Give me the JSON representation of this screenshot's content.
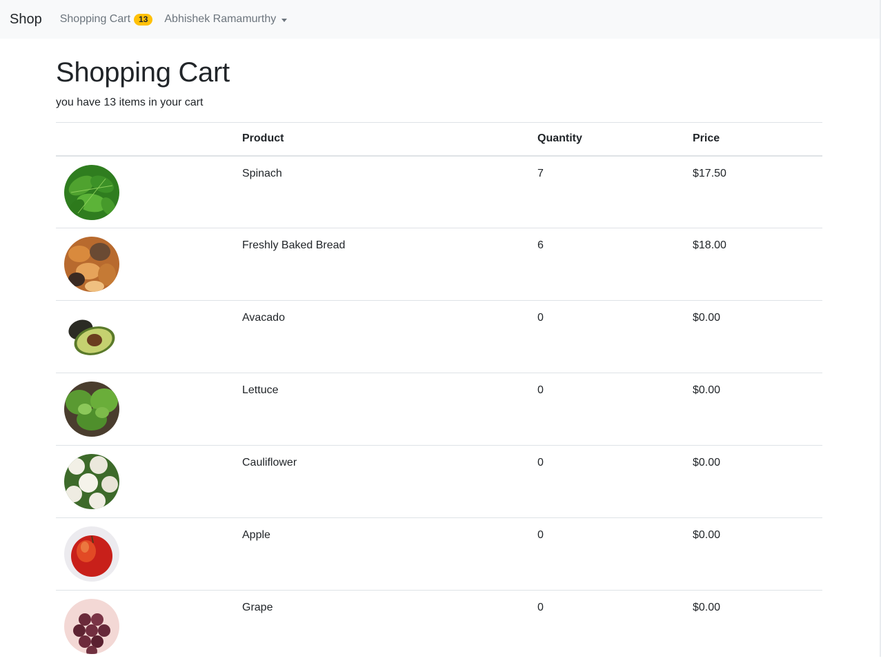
{
  "navbar": {
    "brand": "Shop",
    "cart_label": "Shopping Cart",
    "cart_count": "13",
    "user_name": "Abhishek Ramamurthy"
  },
  "page": {
    "title": "Shopping Cart",
    "subtitle": "you have 13 items in your cart"
  },
  "table": {
    "headers": [
      "",
      "Product",
      "Quantity",
      "Price"
    ],
    "rows": [
      {
        "icon": "spinach-image",
        "product": "Spinach",
        "quantity": "7",
        "price": "$17.50"
      },
      {
        "icon": "bread-image",
        "product": "Freshly Baked Bread",
        "quantity": "6",
        "price": "$18.00"
      },
      {
        "icon": "avocado-image",
        "product": "Avacado",
        "quantity": "0",
        "price": "$0.00"
      },
      {
        "icon": "lettuce-image",
        "product": "Lettuce",
        "quantity": "0",
        "price": "$0.00"
      },
      {
        "icon": "cauliflower-image",
        "product": "Cauliflower",
        "quantity": "0",
        "price": "$0.00"
      },
      {
        "icon": "apple-image",
        "product": "Apple",
        "quantity": "0",
        "price": "$0.00"
      },
      {
        "icon": "grape-image",
        "product": "Grape",
        "quantity": "0",
        "price": "$0.00"
      }
    ]
  },
  "colors": {
    "navbar_bg": "#f8f9fa",
    "badge_bg": "#ffc107",
    "nav_link": "#6c757d"
  }
}
